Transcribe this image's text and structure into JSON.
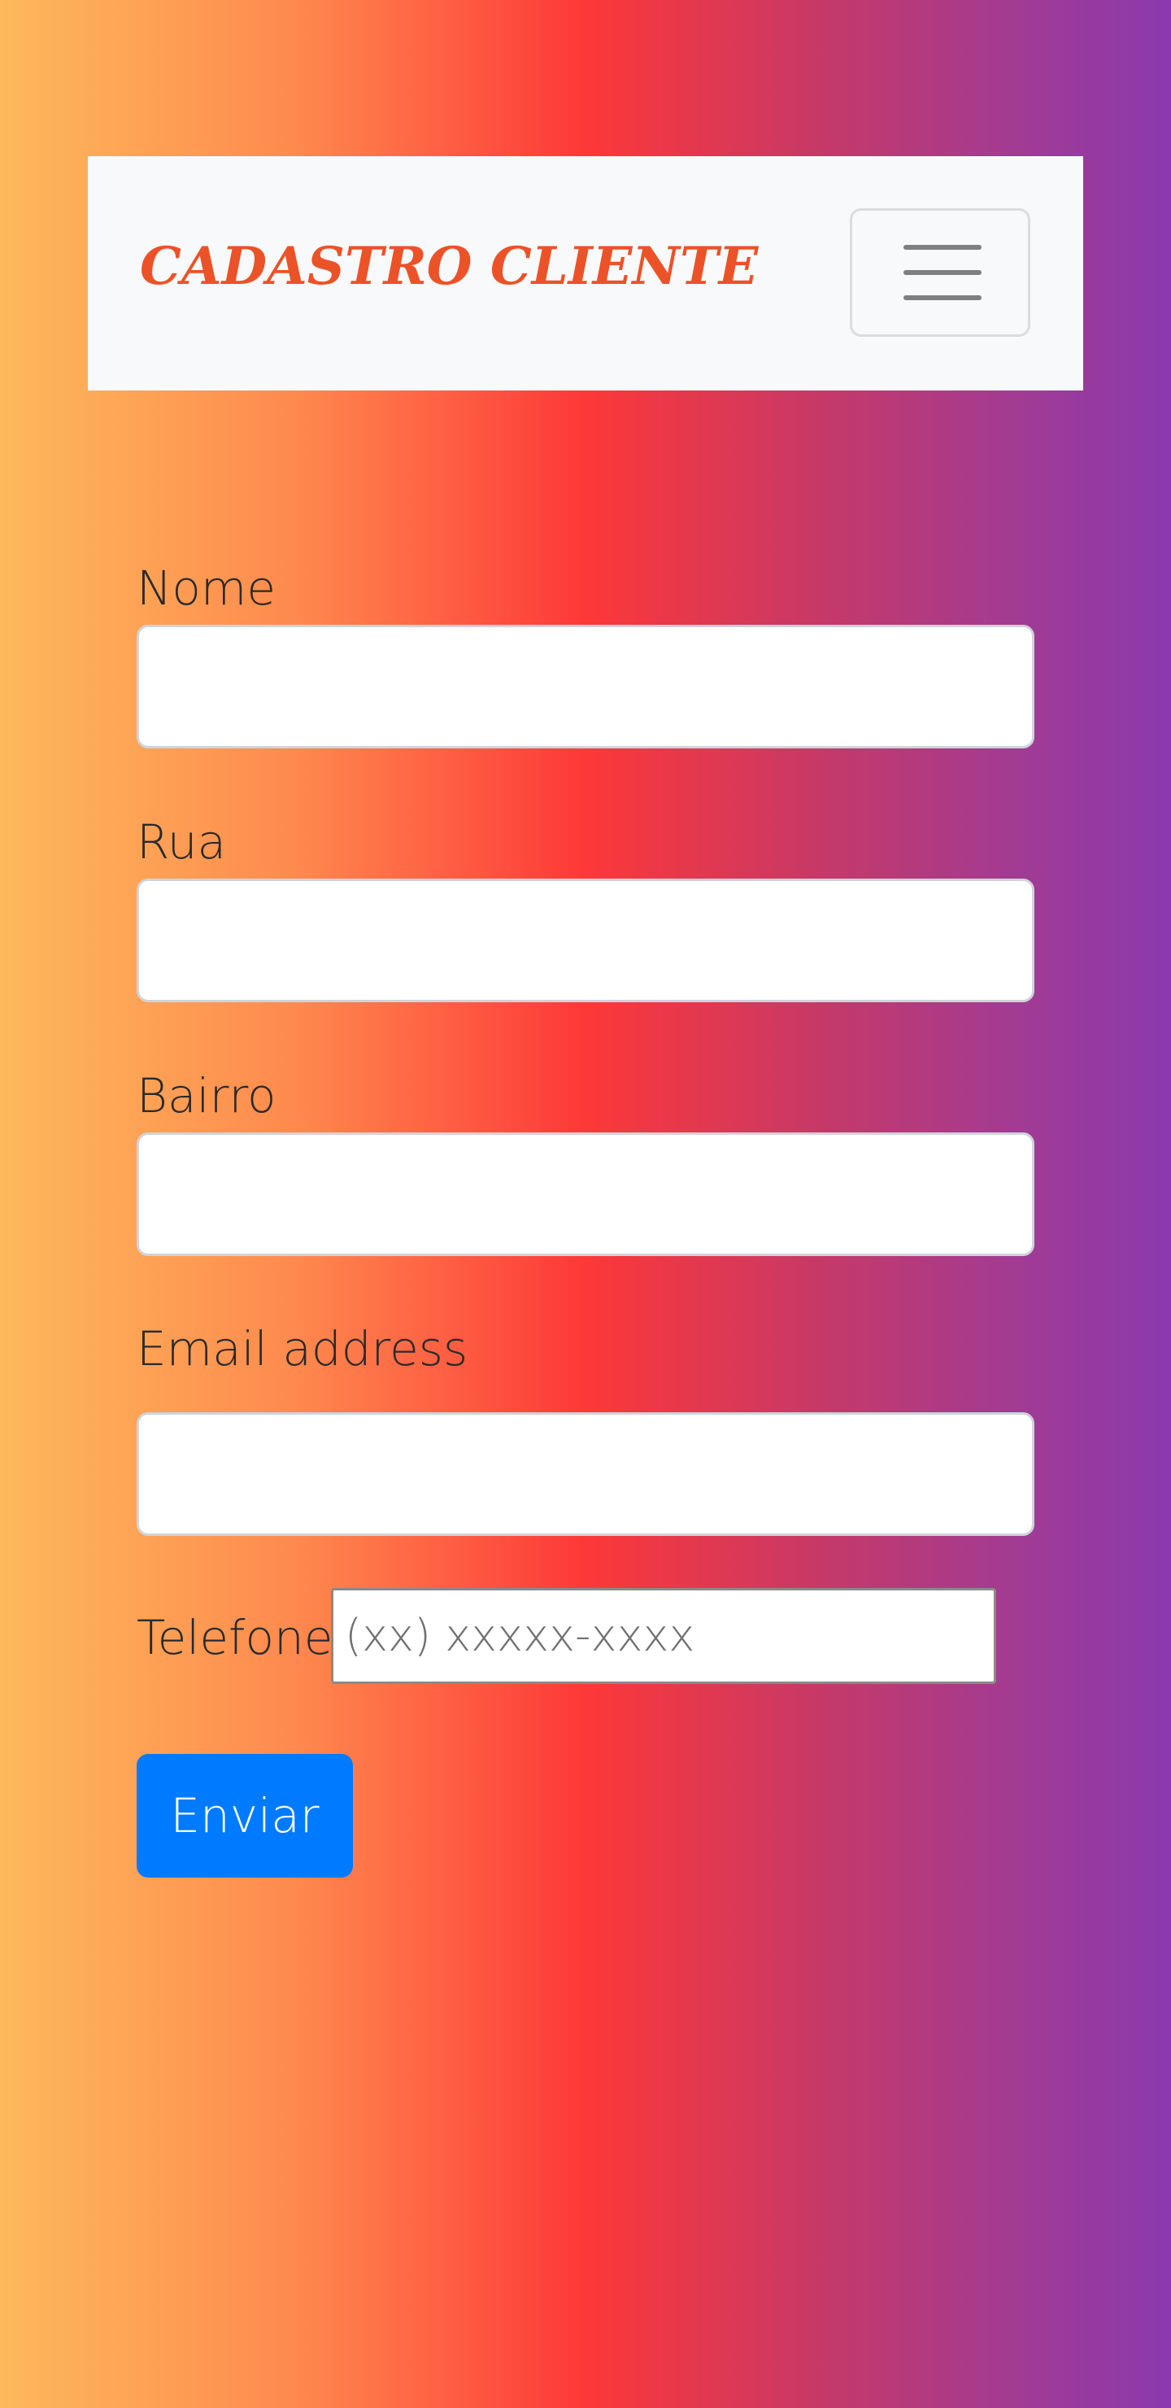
{
  "navbar": {
    "brand": "CADASTRO CLIENTE",
    "toggler_icon": "hamburger-menu-icon"
  },
  "form": {
    "nome_label": "Nome",
    "nome_value": "",
    "rua_label": "Rua",
    "rua_value": "",
    "bairro_label": "Bairro",
    "bairro_value": "",
    "email_label": "Email address",
    "email_value": "",
    "telefone_label": "Telefone",
    "telefone_placeholder": "(xx) xxxxx-xxxx",
    "submit_label": "Enviar"
  },
  "colors": {
    "brand": "#ec5228",
    "button": "#007bff",
    "gradient": [
      "#fdb95c",
      "#fe8a4e",
      "#fd3838",
      "#c63967",
      "#8a3aad"
    ]
  }
}
